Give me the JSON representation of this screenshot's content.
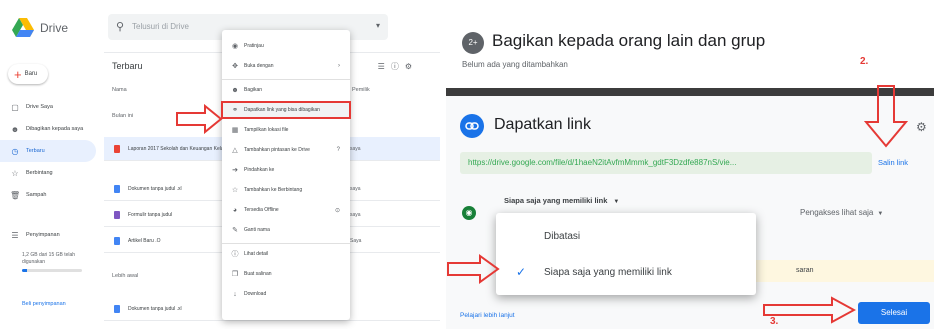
{
  "drive": {
    "logo_text": "Drive",
    "search_placeholder": "Telusuri di Drive",
    "new_label": "Baru",
    "nav": [
      {
        "icon": "computer-icon",
        "label": "Drive Saya"
      },
      {
        "icon": "people-icon",
        "label": "Dibagikan kepada saya"
      },
      {
        "icon": "clock-icon",
        "label": "Terbaru"
      },
      {
        "icon": "star-icon",
        "label": "Berbintang"
      },
      {
        "icon": "trash-icon",
        "label": "Sampah"
      },
      {
        "icon": "storage-icon",
        "label": "Penyimpanan"
      }
    ],
    "storage_text": "1,2 GB dari 15 GB telah digunakan",
    "storage_fraction": 0.08,
    "buy_storage": "Beli penyimpanan",
    "main_title": "Terbaru",
    "col_name": "Nama",
    "col_owner": "Pemilik",
    "section_earlier": "Bulan ini",
    "section_older": "Lebih awal",
    "files": [
      {
        "name": "Laporan 2017 Sekolah dan Keuangan Kelas.pdf",
        "owner": "saya",
        "color": "#ea4335",
        "selected": true
      },
      {
        "name": "Dokumen tanpa judul .xl",
        "owner": "saya",
        "color": "#4285f4",
        "selected": false
      },
      {
        "name": "Formulir tanpa judul",
        "owner": "saya",
        "color": "#7e57c2",
        "selected": false
      },
      {
        "name": "Artikel Baru .O",
        "owner": "Saya",
        "color": "#4285f4",
        "selected": false
      },
      {
        "name": "Dokumen tanpa judul .xl",
        "owner": "",
        "color": "#4285f4",
        "selected": false
      }
    ]
  },
  "context_menu": {
    "items": [
      {
        "icon": "eye-icon",
        "label": "Pratinjau",
        "extra": ""
      },
      {
        "icon": "open-with-icon",
        "label": "Buka dengan",
        "extra": "›"
      },
      {
        "icon": "person-add-icon",
        "label": "Bagikan",
        "extra": ""
      },
      {
        "icon": "link-icon",
        "label": "Dapatkan link yang bisa dibagikan",
        "extra": "",
        "highlight": true
      },
      {
        "icon": "folder-move-icon",
        "label": "Tampilkan lokasi file",
        "extra": ""
      },
      {
        "icon": "drive-add-icon",
        "label": "Tambahkan pintasan ke Drive",
        "extra": "?"
      },
      {
        "icon": "move-icon",
        "label": "Pindahkan ke",
        "extra": ""
      },
      {
        "icon": "star-icon",
        "label": "Tambahkan ke Berbintang",
        "extra": ""
      },
      {
        "icon": "offline-icon",
        "label": "Tersedia Offline",
        "extra": "⊙"
      },
      {
        "icon": "rename-icon",
        "label": "Ganti nama",
        "extra": ""
      },
      {
        "icon": "info-icon",
        "label": "Lihat detail",
        "extra": ""
      },
      {
        "icon": "copy-icon",
        "label": "Buat salinan",
        "extra": ""
      },
      {
        "icon": "download-icon",
        "label": "Download",
        "extra": ""
      }
    ]
  },
  "share": {
    "avatar_text": "2+",
    "title": "Bagikan kepada orang lain dan grup",
    "subtitle": "Belum ada yang ditambahkan",
    "link_title": "Dapatkan link",
    "link_url": "https://drive.google.com/file/d/1haeN2itAvfmMmmk_gdtF3Dzdfe887nS/vie...",
    "copy_link": "Salin link",
    "access_label": "Siapa saja yang memiliki link",
    "role_label": "Pengakses lihat saja",
    "banner_text": "saran",
    "learn_more": "Pelajari lebih lanjut",
    "done": "Selesai",
    "dropdown": [
      {
        "label": "Dibatasi",
        "checked": false
      },
      {
        "label": "Siapa saja yang memiliki link",
        "checked": true
      }
    ]
  },
  "annotations": {
    "step2": "2.",
    "step3": "3.",
    "arrow_color": "#e53935"
  }
}
